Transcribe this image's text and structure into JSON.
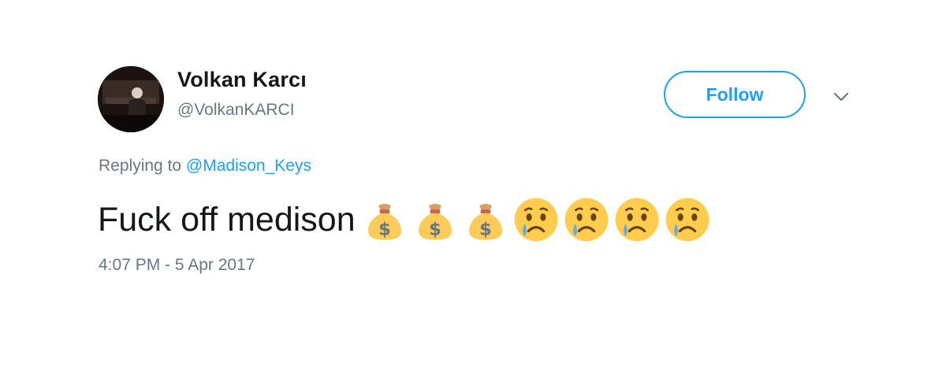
{
  "author": {
    "display_name": "Volkan Karcı",
    "handle": "@VolkanKARCI"
  },
  "actions": {
    "follow_label": "Follow",
    "more_icon": "chevron-down-icon"
  },
  "reply": {
    "prefix": "Replying to",
    "mention": "@Madison_Keys"
  },
  "tweet": {
    "text": "Fuck off medison",
    "emojis": [
      "money-bag",
      "money-bag",
      "money-bag",
      "crying-face",
      "crying-face",
      "crying-face",
      "crying-face"
    ]
  },
  "timestamp": "4:07 PM - 5 Apr 2017",
  "colors": {
    "accent": "#1da1f2",
    "text_primary": "#14171a",
    "text_secondary": "#657786"
  }
}
